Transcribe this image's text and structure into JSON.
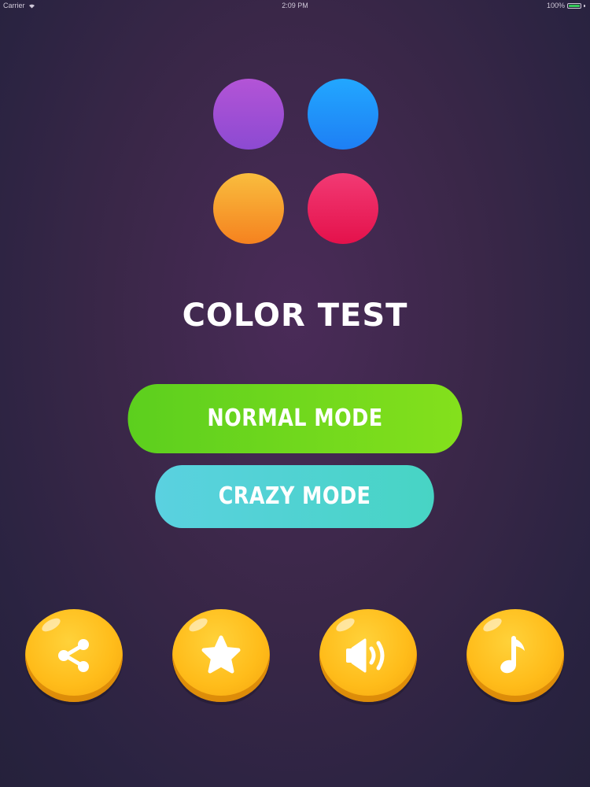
{
  "status_bar": {
    "carrier": "Carrier",
    "time": "2:09 PM",
    "battery": "100%",
    "battery_color": "#35c759"
  },
  "logo": {
    "dots": [
      {
        "name": "purple",
        "color_top": "#b354d6",
        "color_bottom": "#8c4ad2"
      },
      {
        "name": "blue",
        "color_top": "#22a7ff",
        "color_bottom": "#1e7ff4"
      },
      {
        "name": "orange",
        "color_top": "#f9bd3e",
        "color_bottom": "#f5821f"
      },
      {
        "name": "pink",
        "color_top": "#f23a74",
        "color_bottom": "#e4114b"
      }
    ]
  },
  "title": "COLOR TEST",
  "buttons": {
    "normal_mode": "NORMAL MODE",
    "crazy_mode": "CRAZY MODE",
    "normal_color_left": "#5ccf1e",
    "normal_color_right": "#84e01c",
    "crazy_color_left": "#5ad1e0",
    "crazy_color_right": "#47d4c4"
  },
  "icon_buttons": [
    {
      "name": "share-icon"
    },
    {
      "name": "star-icon"
    },
    {
      "name": "sound-icon"
    },
    {
      "name": "music-note-icon"
    }
  ]
}
